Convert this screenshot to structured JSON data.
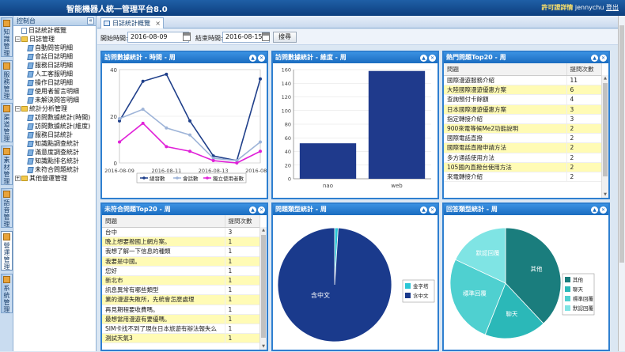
{
  "app": {
    "title": "智能機器人統一管理平台8.0",
    "license_label": "許可證詳情",
    "user": "jennychu",
    "logout_label": "登出"
  },
  "left_strip": [
    {
      "label": "知識管理"
    },
    {
      "label": "服務管理"
    },
    {
      "label": "渠道管理"
    },
    {
      "label": "素材管理"
    },
    {
      "label": "語音管理"
    },
    {
      "label": "營運管理",
      "active": true
    },
    {
      "label": "系統管理"
    }
  ],
  "nav": {
    "header": "控制台",
    "items": [
      {
        "label": "日誌統計概覽",
        "level": 1,
        "type": "doc"
      },
      {
        "label": "日誌管理",
        "level": 0,
        "type": "folder",
        "toggle": "−"
      },
      {
        "label": "自動問答明細",
        "level": 2,
        "type": "page"
      },
      {
        "label": "會話日誌明細",
        "level": 2,
        "type": "page"
      },
      {
        "label": "服務日誌明細",
        "level": 2,
        "type": "page"
      },
      {
        "label": "人工客服明細",
        "level": 2,
        "type": "page"
      },
      {
        "label": "操作日誌明細",
        "level": 2,
        "type": "page"
      },
      {
        "label": "使用者留言明細",
        "level": 2,
        "type": "page"
      },
      {
        "label": "未解決問答明細",
        "level": 2,
        "type": "page"
      },
      {
        "label": "統計分析管理",
        "level": 0,
        "type": "folder",
        "toggle": "−"
      },
      {
        "label": "訪問數據統計(時間)",
        "level": 2,
        "type": "page"
      },
      {
        "label": "訪問數據統計(維度)",
        "level": 2,
        "type": "page"
      },
      {
        "label": "服務日誌統計",
        "level": 2,
        "type": "page"
      },
      {
        "label": "知識點調查統計",
        "level": 2,
        "type": "page"
      },
      {
        "label": "滿意度調查統計",
        "level": 2,
        "type": "page"
      },
      {
        "label": "知識點排名統計",
        "level": 2,
        "type": "page"
      },
      {
        "label": "未符合問題統計",
        "level": 2,
        "type": "page"
      },
      {
        "label": "其他營運管理",
        "level": 0,
        "type": "folder",
        "toggle": "+"
      }
    ]
  },
  "tab": {
    "label": "日誌統計概覽",
    "close": "×"
  },
  "filter": {
    "start_label": "開始時間:",
    "start_value": "2016-08-09",
    "end_label": "結束時間:",
    "end_value": "2016-08-15",
    "search_label": "搜尋"
  },
  "panels": {
    "time_stats": {
      "title": "訪問數據統計 - 時間 - 周"
    },
    "dim_stats": {
      "title": "訪問數據統計 - 維度 - 周"
    },
    "hot_questions": {
      "title": "熱門問題Top20 - 周",
      "col_question": "問題",
      "col_count": "提問次數",
      "rows": [
        {
          "q": "國際漫遊服務介紹",
          "n": "11"
        },
        {
          "q": "大陸國際漫遊優惠方案",
          "n": "6"
        },
        {
          "q": "查詢預付卡餘額",
          "n": "4"
        },
        {
          "q": "日本國際漫遊優惠方案",
          "n": "3"
        },
        {
          "q": "指定轉接介紹",
          "n": "3"
        },
        {
          "q": "900來電等候Me2功能說明",
          "n": "2"
        },
        {
          "q": "國際電話直撥",
          "n": "2"
        },
        {
          "q": "國際電話直撥申請方法",
          "n": "2"
        },
        {
          "q": "多方通話使用方法",
          "n": "2"
        },
        {
          "q": "105國內直撥台使用方法",
          "n": "2"
        },
        {
          "q": "來電轉接介紹",
          "n": "2"
        }
      ]
    },
    "unmatched": {
      "title": "未符合問題Top20 - 周",
      "col_question": "問題",
      "col_count": "提問次數",
      "rows": [
        {
          "q": "台中",
          "n": "3"
        },
        {
          "q": "晚上想要撥國上網方案。",
          "n": "1"
        },
        {
          "q": "我想了解一下信息的種類",
          "n": "1"
        },
        {
          "q": "我要是中國。",
          "n": "1"
        },
        {
          "q": "您好",
          "n": "1"
        },
        {
          "q": "新北市",
          "n": "1"
        },
        {
          "q": "訊息異常有哪些類型",
          "n": "1"
        },
        {
          "q": "業的漫遊失敗所，先統會怎麼處理",
          "n": "1"
        },
        {
          "q": "再見期程要收費嗎。",
          "n": "1"
        },
        {
          "q": "最想當用漫遊有要優嗎。",
          "n": "1"
        },
        {
          "q": "SIM卡找不到了現在日本旅遊有辦法報失么",
          "n": "1"
        },
        {
          "q": "測試天氣3",
          "n": "1"
        }
      ]
    },
    "qtype": {
      "title": "問題類型統計 - 周"
    },
    "atype": {
      "title": "回答類型統計 - 周"
    }
  },
  "chart_data": [
    {
      "type": "line",
      "x": [
        "2016-08-09",
        "2016-08-10",
        "2016-08-11",
        "2016-08-12",
        "2016-08-13",
        "2016-08-14",
        "2016-08-15"
      ],
      "x_tick_labels": [
        "2016-08-09",
        "2016-08-11",
        "2016-08-13",
        "2016-08-15"
      ],
      "ylim": [
        0,
        40
      ],
      "y_ticks": [
        0,
        20,
        40
      ],
      "legend_position": "bottom",
      "series": [
        {
          "name": "總發數",
          "color": "#1f3f8a",
          "values": [
            18,
            35,
            38,
            18,
            3,
            1,
            36
          ]
        },
        {
          "name": "會話數",
          "color": "#9eb4d8",
          "values": [
            19,
            23,
            15,
            12,
            2,
            1,
            9
          ]
        },
        {
          "name": "獨立使用者數",
          "color": "#e020d8",
          "values": [
            9,
            17,
            7,
            5,
            1,
            0,
            5
          ]
        }
      ]
    },
    {
      "type": "bar",
      "categories": [
        "nao",
        "web"
      ],
      "values": [
        52,
        158
      ],
      "ylim": [
        0,
        160
      ],
      "y_ticks": [
        0,
        20,
        40,
        60,
        80,
        100,
        120,
        140,
        160
      ],
      "color": "#1f3a8c"
    },
    {
      "type": "pie",
      "labels": [
        "金字塔",
        "含中文"
      ],
      "values": [
        1,
        99
      ],
      "colors": [
        "#2bc6d6",
        "#1a3a8c"
      ],
      "slice_labels": [
        "含中文"
      ]
    },
    {
      "type": "pie",
      "labels": [
        "其他",
        "聊天",
        "標準回覆",
        "默認回覆"
      ],
      "values": [
        38,
        18,
        26,
        18
      ],
      "colors": [
        "#1a7d7d",
        "#2bb8b8",
        "#4fd0d0",
        "#7fe4e4"
      ]
    }
  ]
}
